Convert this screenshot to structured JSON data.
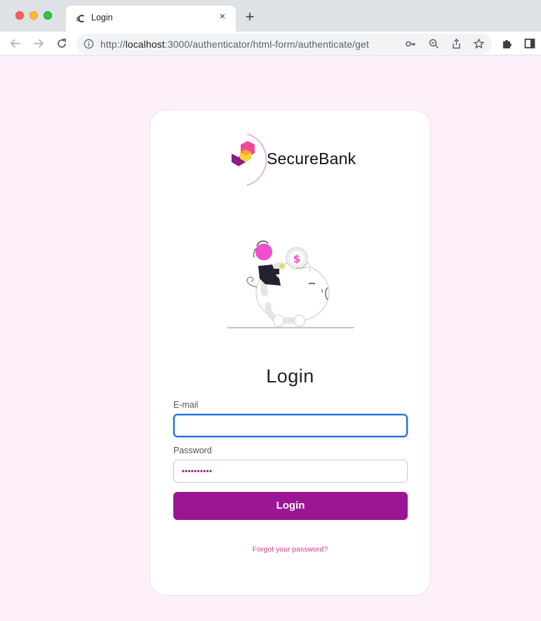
{
  "browser": {
    "tab_title": "Login",
    "tab_close": "×",
    "new_tab": "+",
    "url_prefix": "http://",
    "url_host": "localhost",
    "url_rest": ":3000/authenticator/html-form/authenticate/get"
  },
  "logo": {
    "brand_name": "SecureBank"
  },
  "form": {
    "title": "Login",
    "email_label": "E-mail",
    "email_value": "",
    "password_label": "Password",
    "password_mask": "••••••••••",
    "submit_label": "Login",
    "forgot_link": "Forgot your password?"
  },
  "colors": {
    "accent": "#9c1594",
    "link": "#d03c8e",
    "page_bg": "#fdf0fb",
    "focus_ring": "#1a6fdb"
  }
}
